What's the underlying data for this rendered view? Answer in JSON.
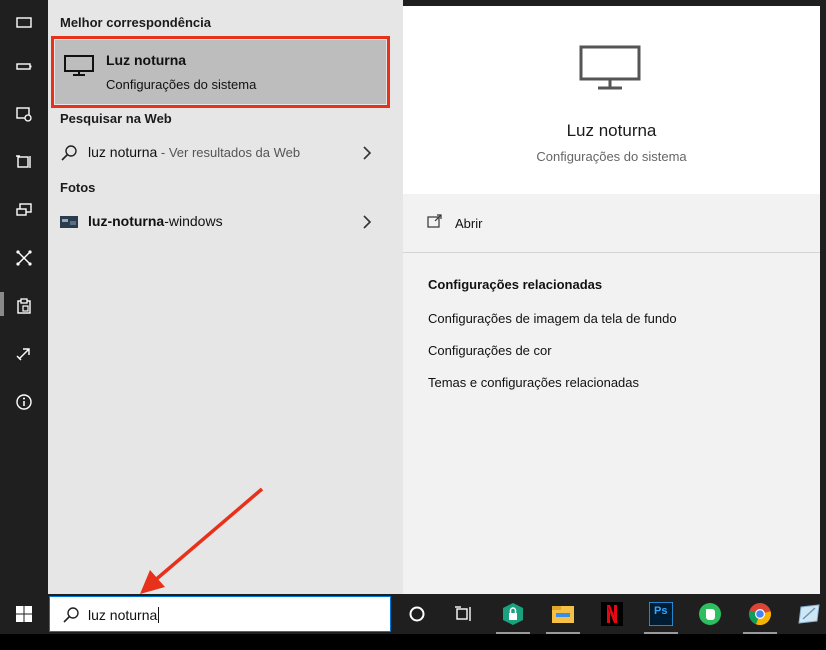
{
  "sidebar": {
    "items": [
      {
        "icon": "monitor-outline-icon"
      },
      {
        "icon": "battery-icon"
      },
      {
        "icon": "notifications-icon"
      },
      {
        "icon": "multitasking-icon"
      },
      {
        "icon": "project-display-icon"
      },
      {
        "icon": "shared-experiences-icon"
      },
      {
        "icon": "clipboard-icon"
      },
      {
        "icon": "remote-desktop-icon"
      },
      {
        "icon": "about-info-icon"
      }
    ]
  },
  "results": {
    "best_match_heading": "Melhor correspondência",
    "best_match": {
      "title": "Luz noturna",
      "subtitle": "Configurações do sistema",
      "icon": "monitor-icon"
    },
    "web_heading": "Pesquisar na Web",
    "web_result": {
      "query": "luz noturna",
      "suffix": " - Ver resultados da Web",
      "icon": "search-icon"
    },
    "photos_heading": "Fotos",
    "photo_result": {
      "bold": "luz-noturna",
      "rest": "-windows",
      "icon": "photo-thumbnail-icon"
    }
  },
  "detail": {
    "title": "Luz noturna",
    "subtitle": "Configurações do sistema",
    "open_label": "Abrir",
    "related_heading": "Configurações relacionadas",
    "related_links": [
      "Configurações de imagem da tela de fundo",
      "Configurações de cor",
      "Temas e configurações relacionadas"
    ]
  },
  "taskbar": {
    "search_value": "luz noturna",
    "apps": [
      {
        "icon": "cortana-icon"
      },
      {
        "icon": "task-view-icon"
      },
      {
        "icon": "kaspersky-icon"
      },
      {
        "icon": "file-explorer-icon"
      },
      {
        "icon": "netflix-icon"
      },
      {
        "icon": "photoshop-icon",
        "label": "Ps"
      },
      {
        "icon": "evernote-icon"
      },
      {
        "icon": "chrome-icon"
      },
      {
        "icon": "snip-tool-icon"
      }
    ]
  },
  "colors": {
    "highlight_border": "#e8311a",
    "arrow": "#e8311a",
    "selected_row": "#bdbdbd"
  }
}
